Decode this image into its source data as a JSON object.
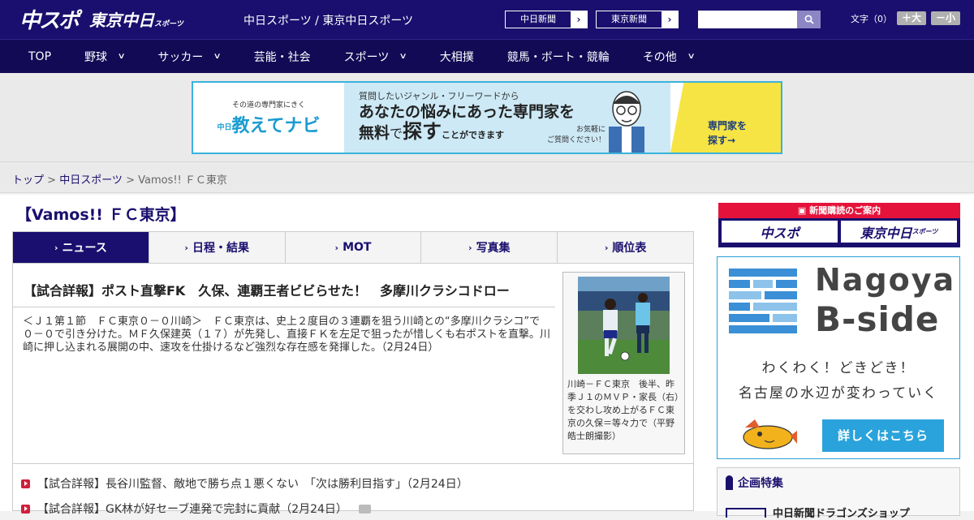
{
  "header": {
    "logo_chuspo": "中スポ",
    "logo_tokyo": "東京中日",
    "logo_tokyo_sub": "スポーツ",
    "site_title": "中日スポーツ / 東京中日スポーツ",
    "link_chunichi": "中日新聞",
    "link_tokyo": "東京新聞",
    "search_placeholder": "",
    "font_size_label": "文字（0）",
    "font_bigger": "＋大",
    "font_smaller": "－小"
  },
  "nav": {
    "items": [
      {
        "label": "TOP",
        "has_menu": false
      },
      {
        "label": "野球",
        "has_menu": true
      },
      {
        "label": "サッカー",
        "has_menu": true
      },
      {
        "label": "芸能・社会",
        "has_menu": false
      },
      {
        "label": "スポーツ",
        "has_menu": true
      },
      {
        "label": "大相撲",
        "has_menu": false
      },
      {
        "label": "競馬・ボート・競輪",
        "has_menu": false
      },
      {
        "label": "その他",
        "has_menu": true
      }
    ]
  },
  "ad_banner": {
    "tagline": "その道の専門家にきく",
    "brand_prefix": "中日",
    "brand_name": "教えてナビ",
    "question": "質問したいジャンル・フリーワードから",
    "headline1": "あなたの悩みにあった専門家を",
    "headline2_a": "無料",
    "headline2_b": "で",
    "headline2_c": "探す",
    "headline2_d": "ことができます",
    "ask_line1": "お気軽に",
    "ask_line2": "ご質問ください！",
    "cta_line1": "専門家を",
    "cta_line2": "探す→"
  },
  "breadcrumb": {
    "home": "トップ",
    "sep1": " > ",
    "section": "中日スポーツ",
    "sep2": " > ",
    "current": "Vamos!! ＦＣ東京"
  },
  "section_title": "【Vamos!! ＦＣ東京】",
  "tabs": [
    {
      "label": "ニュース",
      "active": true
    },
    {
      "label": "日程・結果",
      "active": false
    },
    {
      "label": "MOT",
      "active": false
    },
    {
      "label": "写真集",
      "active": false
    },
    {
      "label": "順位表",
      "active": false
    }
  ],
  "article": {
    "title": "【試合詳報】ポスト直撃FK　久保、連覇王者ビビらせた！　多摩川クラシコドロー",
    "body": "＜Ｊ１第１節　ＦＣ東京０－０川崎＞　ＦＣ東京は、史上２度目の３連覇を狙う川崎との“多摩川クラシコ”で０－０で引き分けた。ＭＦ久保建英（１７）が先発し、直接ＦＫを左足で狙ったが惜しくも右ポストを直撃。川崎に押し込まれる展開の中、速攻を仕掛けるなど強烈な存在感を発揮した。（2月24日）",
    "caption": "川崎－ＦＣ東京　後半、昨季Ｊ１のＭＶＰ・家長（右）を交わし攻め上がるＦＣ東京の久保＝等々力で（平野皓士朗撮影）"
  },
  "related": [
    {
      "text": "【試合詳報】長谷川監督、敵地で勝ち点１悪くない　「次は勝利目指す」（2月24日）",
      "has_photo": false
    },
    {
      "text": "【試合詳報】GK林が好セーブ連発で完封に貢献（2月24日）",
      "has_photo": true
    }
  ],
  "sidebar": {
    "subscribe_head": "新聞購読のご案内",
    "sub_chuspo": "中スポ",
    "sub_tokyo": "東京中日",
    "sub_tokyo_small": "スポーツ",
    "bside_t1": "Nagoya",
    "bside_t2": "B-side",
    "bside_w1": "わくわく！どきどき！",
    "bside_w2": "名古屋の水辺が変わっていく",
    "bside_btn": "詳しくはこちら",
    "feature_head": "企画特集",
    "feature_item": "中日新聞ドラゴンズショップ"
  },
  "colors": {
    "brand": "#1a0f6e",
    "accent_red": "#e5133b",
    "accent_blue": "#2aa3dc"
  }
}
